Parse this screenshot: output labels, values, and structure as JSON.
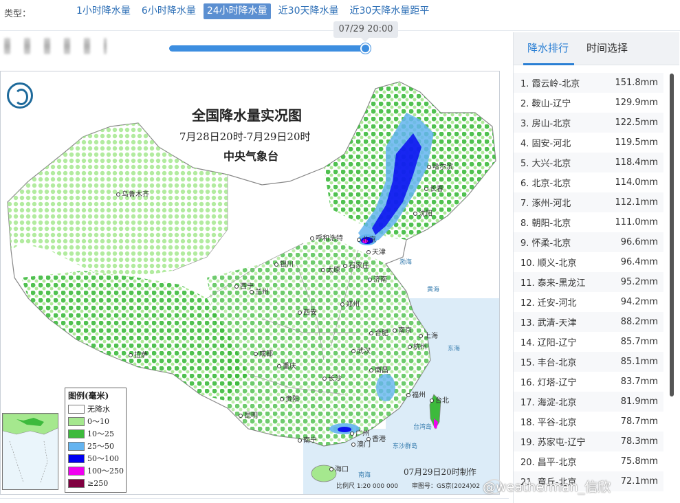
{
  "header": {
    "type_label": "类型：",
    "tabs": [
      {
        "label": "1小时降水量",
        "active": false
      },
      {
        "label": "6小时降水量",
        "active": false
      },
      {
        "label": "24小时降水量",
        "active": true
      },
      {
        "label": "近30天降水量",
        "active": false
      },
      {
        "label": "近30天降水量距平",
        "active": false
      }
    ]
  },
  "timeline": {
    "current_time": "07/29 20:00",
    "progress": 1.0
  },
  "map": {
    "title": "全国降水量实况图",
    "subtitle": "7月28日20时-7月29日20时",
    "issuer": "中央气象台",
    "produced": "07月29日20时制作",
    "scale": "比例尺 1:20 000 000",
    "review_no": "审图号：GS京(2024)02",
    "cities": [
      "乌鲁木齐",
      "拉萨",
      "西宁",
      "兰州",
      "银川",
      "呼和浩特",
      "北京",
      "天津",
      "石家庄",
      "太原",
      "济南",
      "郑州",
      "西安",
      "成都",
      "重庆",
      "贵阳",
      "昆明",
      "南宁",
      "广州",
      "香港",
      "澳门",
      "海口",
      "长沙",
      "南昌",
      "武汉",
      "合肥",
      "南京",
      "上海",
      "杭州",
      "福州",
      "台北",
      "哈尔滨",
      "长春",
      "沈阳"
    ],
    "sea_labels": [
      "渤海",
      "黄海",
      "东海",
      "台湾岛",
      "南海",
      "东沙群岛"
    ],
    "legend": {
      "title": "图例(毫米)",
      "items": [
        {
          "label": "无降水",
          "color": "#ffffff"
        },
        {
          "label": "0～10",
          "color": "#a5e88e"
        },
        {
          "label": "10～25",
          "color": "#3dba3c"
        },
        {
          "label": "25～50",
          "color": "#64b4f0"
        },
        {
          "label": "50～100",
          "color": "#0000f0"
        },
        {
          "label": "100～250",
          "color": "#f000f0"
        },
        {
          "label": "≥250",
          "color": "#800040"
        }
      ]
    }
  },
  "ranking": {
    "tabs": [
      {
        "label": "降水排行",
        "active": true
      },
      {
        "label": "时间选择",
        "active": false
      }
    ],
    "items": [
      {
        "name": "1. 霞云岭-北京",
        "value": "151.8mm"
      },
      {
        "name": "2. 鞍山-辽宁",
        "value": "129.9mm"
      },
      {
        "name": "3. 房山-北京",
        "value": "122.5mm"
      },
      {
        "name": "4. 固安-河北",
        "value": "119.5mm"
      },
      {
        "name": "5. 大兴-北京",
        "value": "118.4mm"
      },
      {
        "name": "6. 北京-北京",
        "value": "114.0mm"
      },
      {
        "name": "7. 涿州-河北",
        "value": "112.1mm"
      },
      {
        "name": "8. 朝阳-北京",
        "value": "111.0mm"
      },
      {
        "name": "9. 怀柔-北京",
        "value": "96.6mm"
      },
      {
        "name": "10. 顺义-北京",
        "value": "96.4mm"
      },
      {
        "name": "11. 泰来-黑龙江",
        "value": "95.2mm"
      },
      {
        "name": "12. 迁安-河北",
        "value": "94.2mm"
      },
      {
        "name": "13. 武清-天津",
        "value": "88.2mm"
      },
      {
        "name": "14. 辽阳-辽宁",
        "value": "85.7mm"
      },
      {
        "name": "15. 丰台-北京",
        "value": "85.1mm"
      },
      {
        "name": "16. 灯塔-辽宁",
        "value": "83.7mm"
      },
      {
        "name": "17. 海淀-北京",
        "value": "81.9mm"
      },
      {
        "name": "18. 平谷-北京",
        "value": "78.7mm"
      },
      {
        "name": "19. 苏家屯-辽宁",
        "value": "78.3mm"
      },
      {
        "name": "20. 昌平-北京",
        "value": "75.8mm"
      },
      {
        "name": "21. 章丘-北京",
        "value": "72.1mm"
      }
    ]
  },
  "watermark": "@weatherman_信欣",
  "colors": {
    "accent": "#2a7fd4",
    "slider": "#3d8ee0",
    "tab_active_bg": "#5b8fd1"
  }
}
